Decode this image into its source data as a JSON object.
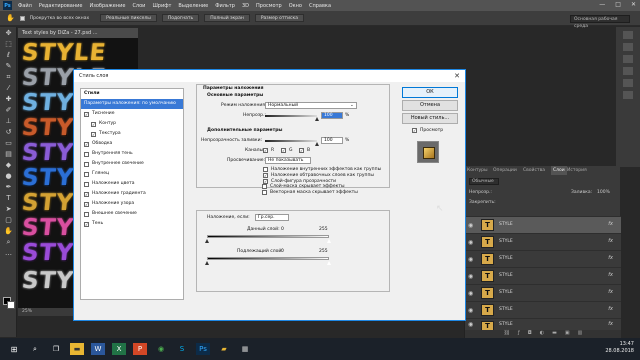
{
  "menubar": {
    "logo": "Ps",
    "items": [
      "Файл",
      "Редактирование",
      "Изображение",
      "Слои",
      "Шрифт",
      "Выделение",
      "Фильтр",
      "3D",
      "Просмотр",
      "Окно",
      "Справка"
    ],
    "window_controls": [
      "—",
      "□",
      "✕"
    ]
  },
  "options_bar": {
    "scroll_all_label": "Прокрутка во всех окнах",
    "buttons": [
      "Реальные пикселы",
      "Подогнать",
      "Полный экран",
      "Размер оттиска"
    ],
    "workspace": "Основная рабочая среда"
  },
  "document": {
    "tab_title": "Text styles by DiZa - 27.psd ...",
    "zoom": "25%",
    "words": [
      "STYLE",
      "STYLE",
      "STYLE",
      "STYLE",
      "STYLE",
      "STYLE",
      "STYLE",
      "STYLE",
      "STYLE",
      "STYLE"
    ],
    "word_colors": [
      "#e8b233",
      "#9aa0a8",
      "#6fb0e0",
      "#c85a2a",
      "#8a5cd6",
      "#2b6fd6",
      "#d4a233",
      "#d94fa0",
      "#9a4bd8",
      "#c9c9c9"
    ]
  },
  "dialog": {
    "title": "Стиль слоя",
    "close": "✕",
    "styles_header": "Стили",
    "fx_items": [
      {
        "label": "Параметры наложения: по умолчанию",
        "checkbox": false,
        "checked": false,
        "selected": true,
        "sub": false
      },
      {
        "label": "Тиснение",
        "checkbox": true,
        "checked": true,
        "selected": false,
        "sub": false
      },
      {
        "label": "Контур",
        "checkbox": true,
        "checked": true,
        "selected": false,
        "sub": true
      },
      {
        "label": "Текстура",
        "checkbox": true,
        "checked": true,
        "selected": false,
        "sub": true
      },
      {
        "label": "Обводка",
        "checkbox": true,
        "checked": true,
        "selected": false,
        "sub": false
      },
      {
        "label": "Внутренняя тень",
        "checkbox": true,
        "checked": false,
        "selected": false,
        "sub": false
      },
      {
        "label": "Внутреннее свечение",
        "checkbox": true,
        "checked": false,
        "selected": false,
        "sub": false
      },
      {
        "label": "Глянец",
        "checkbox": true,
        "checked": false,
        "selected": false,
        "sub": false
      },
      {
        "label": "Наложение цвета",
        "checkbox": true,
        "checked": false,
        "selected": false,
        "sub": false
      },
      {
        "label": "Наложение градиента",
        "checkbox": true,
        "checked": true,
        "selected": false,
        "sub": false
      },
      {
        "label": "Наложение узора",
        "checkbox": true,
        "checked": true,
        "selected": false,
        "sub": false
      },
      {
        "label": "Внешнее свечение",
        "checkbox": true,
        "checked": false,
        "selected": false,
        "sub": false
      },
      {
        "label": "Тень",
        "checkbox": true,
        "checked": true,
        "selected": false,
        "sub": false
      }
    ],
    "blend_section_title": "Параметры наложения",
    "basic_title": "Основные параметры",
    "blend_mode_label": "Режим наложения:",
    "blend_mode_value": "Нормальный",
    "opacity_label": "Непрозр.:",
    "opacity_value": "100",
    "percent": "%",
    "advanced_title": "Дополнительные параметры",
    "fill_label": "Непрозрачность заливки:",
    "fill_value": "100",
    "channels_label": "Каналы:",
    "channels": [
      "R",
      "G",
      "B"
    ],
    "knockout_label": "Просвечивание:",
    "knockout_value": "Не показывать",
    "options": [
      {
        "label": "Наложение внутренних эффектов как группы",
        "checked": false
      },
      {
        "label": "Наложение обтравочных слоев как группы",
        "checked": true
      },
      {
        "label": "Слой-фигура прозрачности",
        "checked": true
      },
      {
        "label": "Слой-маска скрывает эффекты",
        "checked": false
      },
      {
        "label": "Векторная маска скрывает эффекты",
        "checked": false
      }
    ],
    "blend_if_label": "Наложение, если:",
    "blend_if_value": "Гр.сер.",
    "this_layer_label": "Данный слой:",
    "underlying_label": "Подлежащий слой:",
    "range_min": "0",
    "range_max": "255",
    "buttons": {
      "ok": "ОК",
      "cancel": "Отмена",
      "new_style": "Новый стиль...",
      "preview": "Просмотр"
    }
  },
  "layers_panel": {
    "tabs": [
      "Контуры",
      "Операции",
      "Свойства",
      "Слои",
      "История"
    ],
    "kind_filter": "Обычные",
    "opacity_label": "Непрозр.:",
    "opacity_value": "100%",
    "fill_label": "Заливка:",
    "fill_value": "100%",
    "lock_label": "Закрепить:",
    "layers": [
      "STYLE",
      "STYLE",
      "STYLE",
      "STYLE",
      "STYLE",
      "STYLE",
      "STYLE",
      "STYLE"
    ],
    "fx": "fx"
  },
  "taskbar": {
    "time": "13:47",
    "date": "28.08.2018",
    "apps": [
      "start",
      "search",
      "task-view",
      "explorer",
      "word",
      "excel",
      "powerpoint",
      "chrome",
      "skype",
      "photoshop",
      "folder",
      "store"
    ]
  }
}
